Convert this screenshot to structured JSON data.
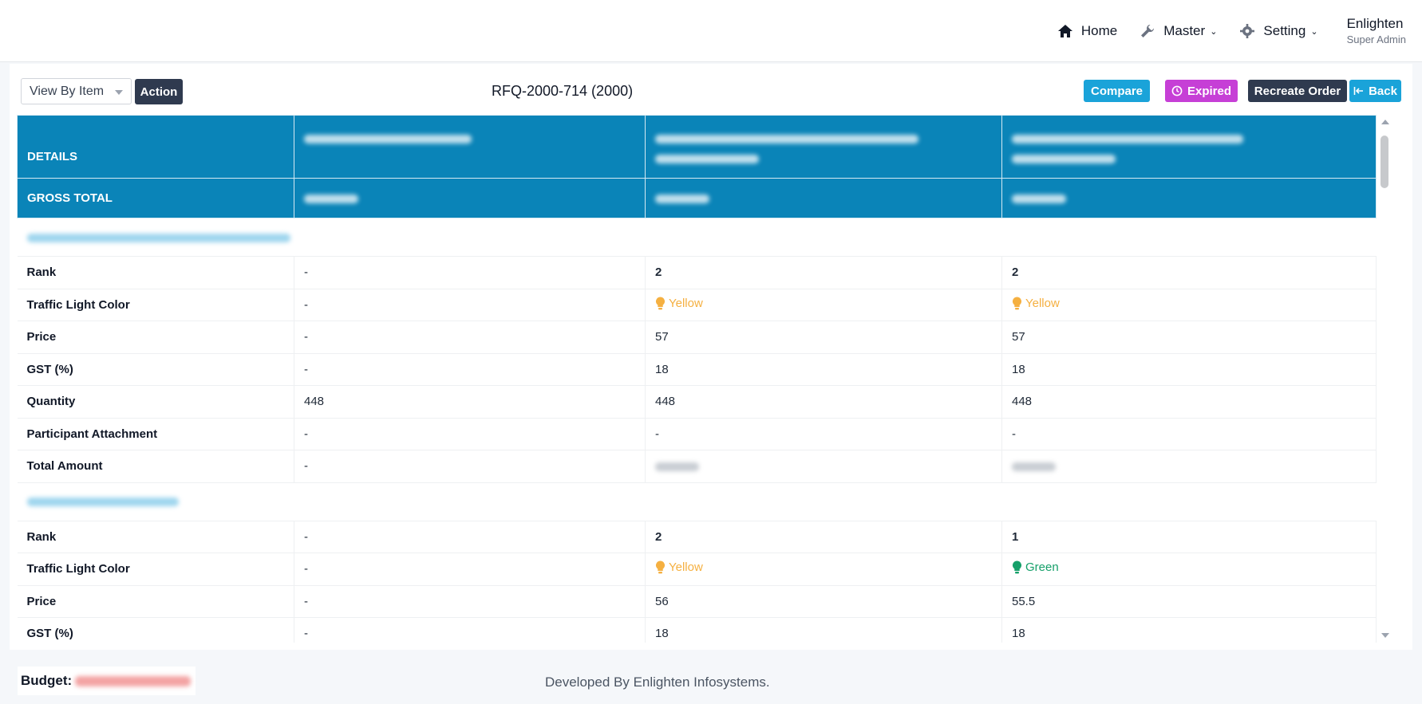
{
  "nav": {
    "home": "Home",
    "master": "Master",
    "setting": "Setting",
    "user_name": "Enlighten",
    "user_role": "Super Admin"
  },
  "toolbar": {
    "view_by": "View By Item",
    "action": "Action",
    "title": "RFQ-2000-714 (2000)",
    "compare": "Compare",
    "expired": "Expired",
    "recreate": "Recreate Order",
    "back": "Back"
  },
  "table": {
    "header_details": "DETAILS",
    "header_gross_total": "GROSS TOTAL",
    "sections": [
      {
        "rows": [
          {
            "label": "Rank",
            "values": [
              "-",
              "2",
              "2"
            ],
            "bold": true
          },
          {
            "label": "Traffic Light Color",
            "values": [
              "-",
              "Yellow",
              "Yellow"
            ],
            "colors": [
              "",
              "yellow",
              "yellow"
            ]
          },
          {
            "label": "Price",
            "values": [
              "-",
              "57",
              "57"
            ]
          },
          {
            "label": "GST (%)",
            "values": [
              "-",
              "18",
              "18"
            ]
          },
          {
            "label": "Quantity",
            "values": [
              "448",
              "448",
              "448"
            ]
          },
          {
            "label": "Participant Attachment",
            "values": [
              "-",
              "-",
              "-"
            ]
          },
          {
            "label": "Total Amount",
            "values": [
              "-",
              "",
              ""
            ]
          }
        ]
      },
      {
        "rows": [
          {
            "label": "Rank",
            "values": [
              "-",
              "2",
              "1"
            ],
            "bold": true
          },
          {
            "label": "Traffic Light Color",
            "values": [
              "-",
              "Yellow",
              "Green"
            ],
            "colors": [
              "",
              "yellow",
              "green"
            ]
          },
          {
            "label": "Price",
            "values": [
              "-",
              "56",
              "55.5"
            ]
          },
          {
            "label": "GST (%)",
            "values": [
              "-",
              "18",
              "18"
            ]
          }
        ]
      }
    ]
  },
  "colors": {
    "header_bg": "#0a84b8",
    "yellow": "#f5b041",
    "green": "#16a06a",
    "compare": "#1aa3d9",
    "expired": "#c63fd6",
    "dark": "#2f3a4f"
  },
  "footer": {
    "budget_label": "Budget:",
    "developed_by": "Developed By Enlighten Infosystems."
  }
}
